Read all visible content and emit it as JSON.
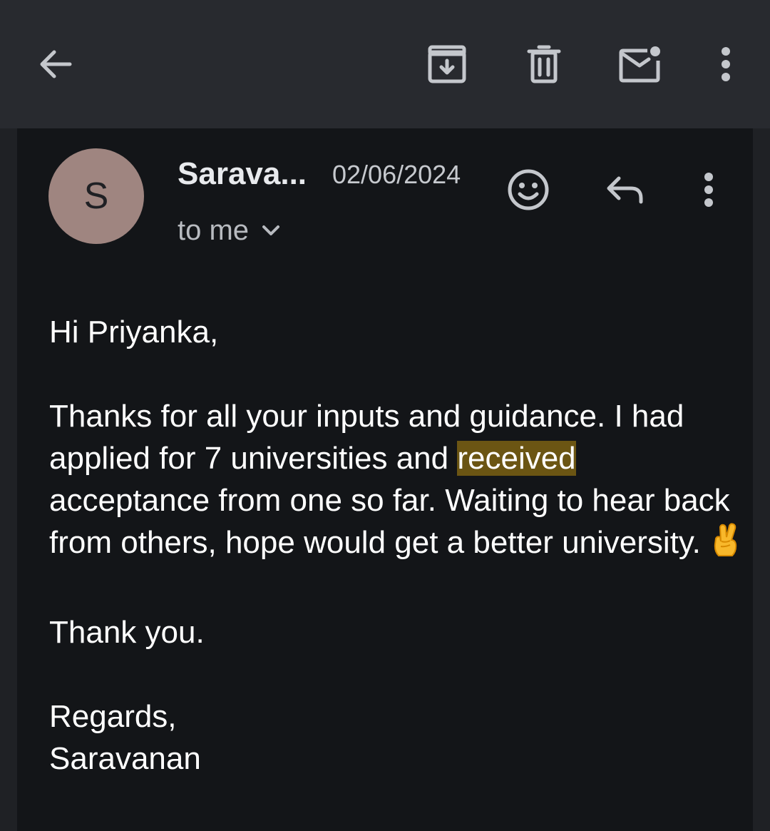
{
  "toolbar": {
    "back_icon": "arrow-left-icon",
    "archive_icon": "archive-icon",
    "delete_icon": "trash-icon",
    "unread_icon": "mark-unread-icon",
    "more_icon": "more-vert-icon"
  },
  "message": {
    "sender_initial": "S",
    "sender_name": "Sarava...",
    "date": "02/06/2024",
    "recipient": "to me",
    "avatar_color": "#9f8580",
    "emoji_react_icon": "smiley-icon",
    "reply_icon": "reply-icon",
    "more_icon": "more-vert-icon"
  },
  "body": {
    "greeting": "Hi Priyanka,",
    "para1_part1": "Thanks for all your inputs and guidance. I had applied for 7 universities and ",
    "para1_highlight": "received",
    "para1_part2": " acceptance from one so far. Waiting to hear back from others, hope would get a better university.",
    "para1_emoji": "crossed-fingers-emoji",
    "thanks": "Thank you.",
    "signoff": "Regards,",
    "signature": "Saravanan",
    "highlight_color": "#6b5513"
  }
}
